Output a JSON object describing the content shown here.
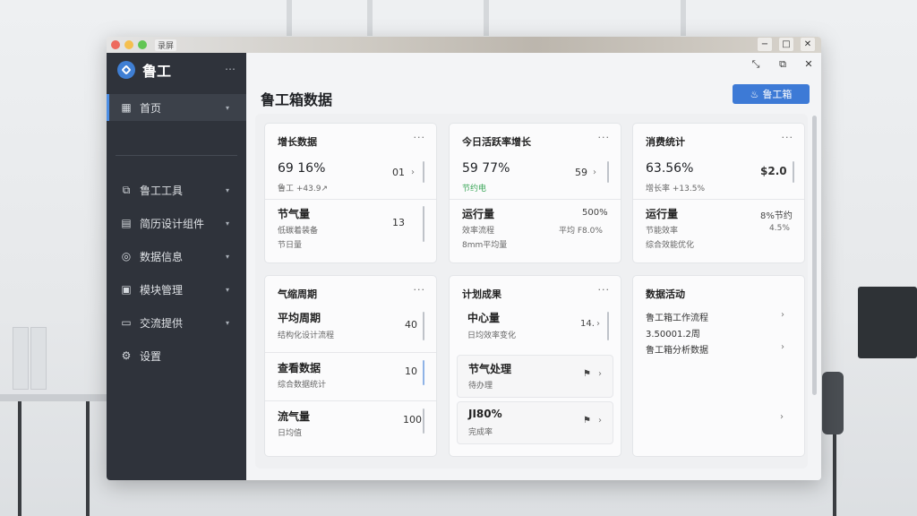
{
  "window": {
    "tab_label": "录屏",
    "controls": {
      "minimize": "−",
      "maximize": "□",
      "close": "✕"
    }
  },
  "sidebar": {
    "logo_text": "鲁工",
    "more": "…",
    "items": [
      {
        "label": "首页",
        "icon": "grid-icon",
        "glyph": "▦"
      },
      {
        "label": "鲁工工具",
        "icon": "apps-icon",
        "glyph": "⧉"
      },
      {
        "label": "简历设计组件",
        "icon": "document-icon",
        "glyph": "▤"
      },
      {
        "label": "数据信息",
        "icon": "compass-icon",
        "glyph": "◎"
      },
      {
        "label": "模块管理",
        "icon": "box-icon",
        "glyph": "▣"
      },
      {
        "label": "交流提供",
        "icon": "chat-icon",
        "glyph": "▭"
      },
      {
        "label": "设置",
        "icon": "gear-icon",
        "glyph": "⚙"
      }
    ]
  },
  "main": {
    "title": "鲁工箱数据",
    "primary_button": "鲁工箱",
    "top_controls": {
      "expand": "⤡",
      "copy": "⧉",
      "close": "✕"
    }
  },
  "cards": [
    {
      "title": "增长数据",
      "more": "···",
      "primary": {
        "value": "69 16%",
        "sub": "鲁工 +43.9↗",
        "right": "01"
      },
      "secondary": {
        "title": "节气量",
        "line1": "低碳着装备",
        "line2": "节日量",
        "right": "13"
      }
    },
    {
      "title": "今日活跃率增长",
      "more": "···",
      "primary": {
        "value": "59 77%",
        "sub": "节约电",
        "right": "59"
      },
      "secondary": {
        "title": "运行量",
        "line1": "效率流程",
        "line2": "8mm平均量",
        "right": "500%",
        "right2": "平均 F8.0%"
      }
    },
    {
      "title": "消费统计",
      "more": "···",
      "primary": {
        "value": "63.56%",
        "sub": "增长率 +13.5%",
        "right": "$2.0"
      },
      "secondary": {
        "title": "运行量",
        "line1": "节能效率",
        "line2": "综合效能优化",
        "right": "8%节约",
        "right2": "4.5%"
      }
    },
    {
      "title": "气缩周期",
      "more": "···",
      "rows": [
        {
          "title": "平均周期",
          "sub": "结构化设计流程",
          "value": "40"
        },
        {
          "title": "查看数据",
          "sub": "综合数据统计",
          "value": "10"
        },
        {
          "title": "流气量",
          "sub": "日均值",
          "value": "100"
        }
      ]
    },
    {
      "title": "计划成果",
      "more": "···",
      "rows": [
        {
          "title": "中心量",
          "sub": "日均效率变化",
          "value": "14."
        },
        {
          "title": "节气处理",
          "sub": "待办理",
          "value": "⚑"
        },
        {
          "title": "JI80%",
          "sub": "完成率",
          "value": "⚑"
        }
      ]
    },
    {
      "title": "数据活动",
      "more": "",
      "rows": [
        {
          "title": "鲁工箱工作流程"
        },
        {
          "title": "3.50001.2周"
        },
        {
          "title": "鲁工箱分析数据"
        }
      ]
    }
  ]
}
